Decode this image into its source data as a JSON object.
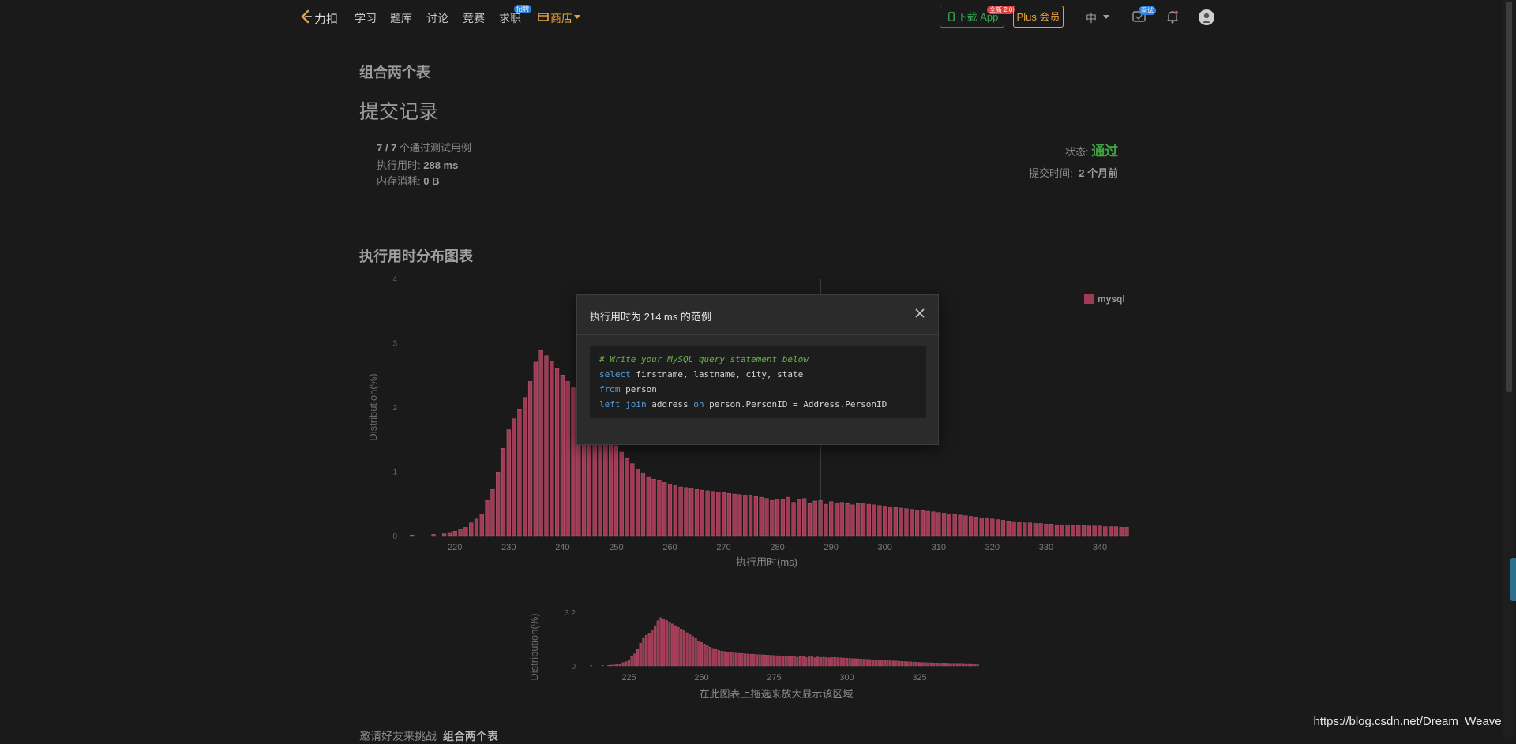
{
  "nav": {
    "logo": "力扣",
    "items": [
      "学习",
      "题库",
      "讨论",
      "竞赛",
      "求职"
    ],
    "jobs_badge": "招聘",
    "store": "商店",
    "download_app": "下载 App",
    "download_badge": "全新 2.0",
    "plus": "Plus 会员",
    "language": "中",
    "interview_badge": "面试"
  },
  "problem": {
    "name": "组合两个表",
    "page_title": "提交记录"
  },
  "result": {
    "testcases_count": "7 / 7",
    "testcases_label": "个通过测试用例",
    "runtime_label": "执行用时:",
    "runtime_value": "288 ms",
    "memory_label": "内存消耗:",
    "memory_value": "0 B",
    "status_label": "状态:",
    "status_value": "通过",
    "submitted_label": "提交时间:",
    "submitted_value": "2 个月前"
  },
  "chart_section_title": "执行用时分布图表",
  "chart_data": [
    {
      "type": "bar",
      "xlabel": "执行用时(ms)",
      "ylabel": "Distribution(%)",
      "xlim": [
        211,
        345
      ],
      "ylim": [
        0,
        4
      ],
      "xticks": [
        220,
        230,
        240,
        250,
        260,
        270,
        280,
        290,
        300,
        310,
        320,
        330,
        340
      ],
      "yticks": [
        0,
        1,
        2,
        3,
        4
      ],
      "legend": "top-right",
      "series": [
        {
          "name": "mysql",
          "color": "#a33a55"
        }
      ],
      "x_start": 212,
      "x_step": 1,
      "values": [
        0.01,
        0.0,
        0.0,
        0.0,
        0.02,
        0.0,
        0.03,
        0.05,
        0.07,
        0.1,
        0.13,
        0.2,
        0.26,
        0.34,
        0.55,
        0.72,
        0.99,
        1.36,
        1.65,
        1.82,
        1.96,
        2.15,
        2.4,
        2.7,
        2.88,
        2.8,
        2.71,
        2.6,
        2.5,
        2.4,
        2.3,
        2.2,
        2.1,
        1.98,
        1.86,
        1.75,
        1.64,
        1.5,
        1.4,
        1.3,
        1.2,
        1.12,
        1.04,
        0.98,
        0.92,
        0.88,
        0.86,
        0.83,
        0.8,
        0.78,
        0.76,
        0.75,
        0.74,
        0.72,
        0.71,
        0.7,
        0.69,
        0.68,
        0.67,
        0.66,
        0.65,
        0.64,
        0.63,
        0.62,
        0.61,
        0.6,
        0.58,
        0.55,
        0.57,
        0.56,
        0.6,
        0.52,
        0.56,
        0.58,
        0.5,
        0.54,
        0.55,
        0.49,
        0.53,
        0.51,
        0.52,
        0.5,
        0.48,
        0.5,
        0.51,
        0.49,
        0.48,
        0.47,
        0.46,
        0.45,
        0.44,
        0.43,
        0.42,
        0.41,
        0.4,
        0.39,
        0.38,
        0.37,
        0.36,
        0.35,
        0.34,
        0.33,
        0.32,
        0.31,
        0.3,
        0.29,
        0.28,
        0.27,
        0.26,
        0.25,
        0.24,
        0.23,
        0.22,
        0.21,
        0.2,
        0.2,
        0.19,
        0.19,
        0.18,
        0.18,
        0.17,
        0.17,
        0.17,
        0.16,
        0.16,
        0.16,
        0.15,
        0.15,
        0.15,
        0.14,
        0.14,
        0.14,
        0.13,
        0.13
      ]
    },
    {
      "type": "bar",
      "title": "在此图表上拖选来放大显示该区域",
      "ylabel": "Distribution(%)",
      "xlim": [
        211,
        345
      ],
      "ylim": [
        0,
        3.2
      ],
      "xticks": [
        225,
        250,
        275,
        300,
        325
      ],
      "yticks": [
        0,
        3.2
      ],
      "series": [
        {
          "name": "mysql",
          "color": "#a33a55"
        }
      ],
      "values_ref": "same as main chart"
    }
  ],
  "modal": {
    "title": "执行用时为 214 ms 的范例",
    "code": [
      [
        {
          "t": "# Write your MySQL query statement below",
          "c": "cm"
        }
      ],
      [
        {
          "t": "select",
          "c": "kw"
        },
        {
          "t": " firstname, lastname, city, state",
          "c": ""
        }
      ],
      [
        {
          "t": "from",
          "c": "kw"
        },
        {
          "t": " person",
          "c": ""
        }
      ],
      [
        {
          "t": "left join",
          "c": "kw"
        },
        {
          "t": " address ",
          "c": ""
        },
        {
          "t": "on",
          "c": "kw"
        },
        {
          "t": " person.PersonID = Address.PersonID",
          "c": ""
        }
      ]
    ]
  },
  "footer": {
    "invite_text": "邀请好友来挑战",
    "invite_problem": "组合两个表"
  },
  "watermark": "https://blog.csdn.net/Dream_Weave_"
}
